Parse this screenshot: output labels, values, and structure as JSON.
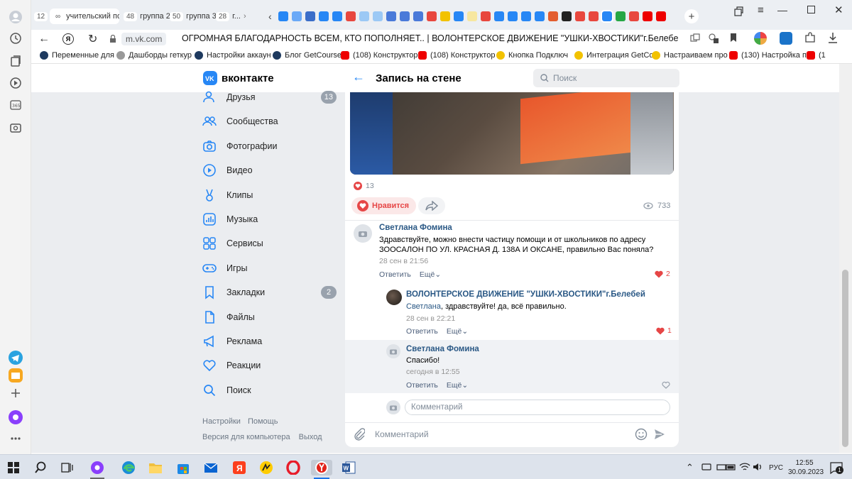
{
  "browser": {
    "tabs": [
      {
        "count": "12",
        "label": ""
      },
      {
        "count": "",
        "label": "учительский пор"
      },
      {
        "count": "48",
        "label": "группа 2"
      },
      {
        "count": "50",
        "label": "группа 3"
      },
      {
        "count": "28",
        "label": "г..."
      }
    ],
    "url": "m.vk.com",
    "page_title": "ОГРОМНАЯ БЛАГОДАРНОСТЬ ВСЕМ, КТО ПОПОЛНЯЕТ.. | ВОЛОНТЕРСКОЕ ДВИЖЕНИЕ \"УШКИ-ХВОСТИКИ\"г.Белебей",
    "bookmarks": [
      "Переменные для",
      "Дашборды геткур",
      "Настройки аккаун",
      "Блог GetCourse",
      "(108) Конструктор",
      "(108) Конструктор",
      "Кнопка Подключ",
      "Интеграция GetCo",
      "Настраиваем про",
      "(130) Настройка п",
      "(1"
    ]
  },
  "vk": {
    "logo": "вконтакте",
    "header_title": "Запись на стене",
    "search_placeholder": "Поиск",
    "nav": [
      {
        "label": "Друзья",
        "badge": "13",
        "icon": "friends-icon"
      },
      {
        "label": "Сообщества",
        "badge": "",
        "icon": "communities-icon"
      },
      {
        "label": "Фотографии",
        "badge": "",
        "icon": "camera-icon"
      },
      {
        "label": "Видео",
        "badge": "",
        "icon": "video-icon"
      },
      {
        "label": "Клипы",
        "badge": "",
        "icon": "clips-icon"
      },
      {
        "label": "Музыка",
        "badge": "",
        "icon": "music-icon"
      },
      {
        "label": "Сервисы",
        "badge": "",
        "icon": "services-icon"
      },
      {
        "label": "Игры",
        "badge": "",
        "icon": "gamepad-icon"
      },
      {
        "label": "Закладки",
        "badge": "2",
        "icon": "bookmark-icon"
      },
      {
        "label": "Файлы",
        "badge": "",
        "icon": "file-icon"
      },
      {
        "label": "Реклама",
        "badge": "",
        "icon": "megaphone-icon"
      },
      {
        "label": "Реакции",
        "badge": "",
        "icon": "heart-icon"
      },
      {
        "label": "Поиск",
        "badge": "",
        "icon": "search-icon"
      }
    ],
    "footer": {
      "settings": "Настройки",
      "help": "Помощь",
      "desktop": "Версия для компьютера",
      "logout": "Выход"
    },
    "post": {
      "likes": "13",
      "like_button": "Нравится",
      "views": "733"
    },
    "comments": [
      {
        "author": "Светлана Фомина",
        "text": "Здравствуйте, можно внести частицу помощи и от школьников по адресу ЗООСАЛОН ПО УЛ. КРАСНАЯ Д. 138А И ОКСАНЕ, правильно Вас поняла?",
        "time": "28 сен в 21:56",
        "reply": "Ответить",
        "more": "Ещё",
        "likes": "2"
      },
      {
        "author": "ВОЛОНТЕРСКОЕ ДВИЖЕНИЕ \"УШКИ-ХВОСТИКИ\"г.Белебей",
        "mention": "Светлана",
        "text": ", здравствуйте! да, всё правильно.",
        "time": "28 сен в 22:21",
        "reply": "Ответить",
        "more": "Ещё",
        "likes": "1"
      },
      {
        "author": "Светлана Фомина",
        "text": "Спасибо!",
        "time": "сегодня в 12:55",
        "reply": "Ответить",
        "more": "Ещё",
        "likes": ""
      }
    ],
    "reply_placeholder": "Комментарий",
    "comment_placeholder": "Комментарий"
  },
  "taskbar": {
    "lang": "РУС",
    "time": "12:55",
    "date": "30.09.2023",
    "notifications": "1"
  },
  "colors": {
    "vk_blue": "#2787f5",
    "like_red": "#e64646",
    "badge_grey": "#99a2ad"
  }
}
